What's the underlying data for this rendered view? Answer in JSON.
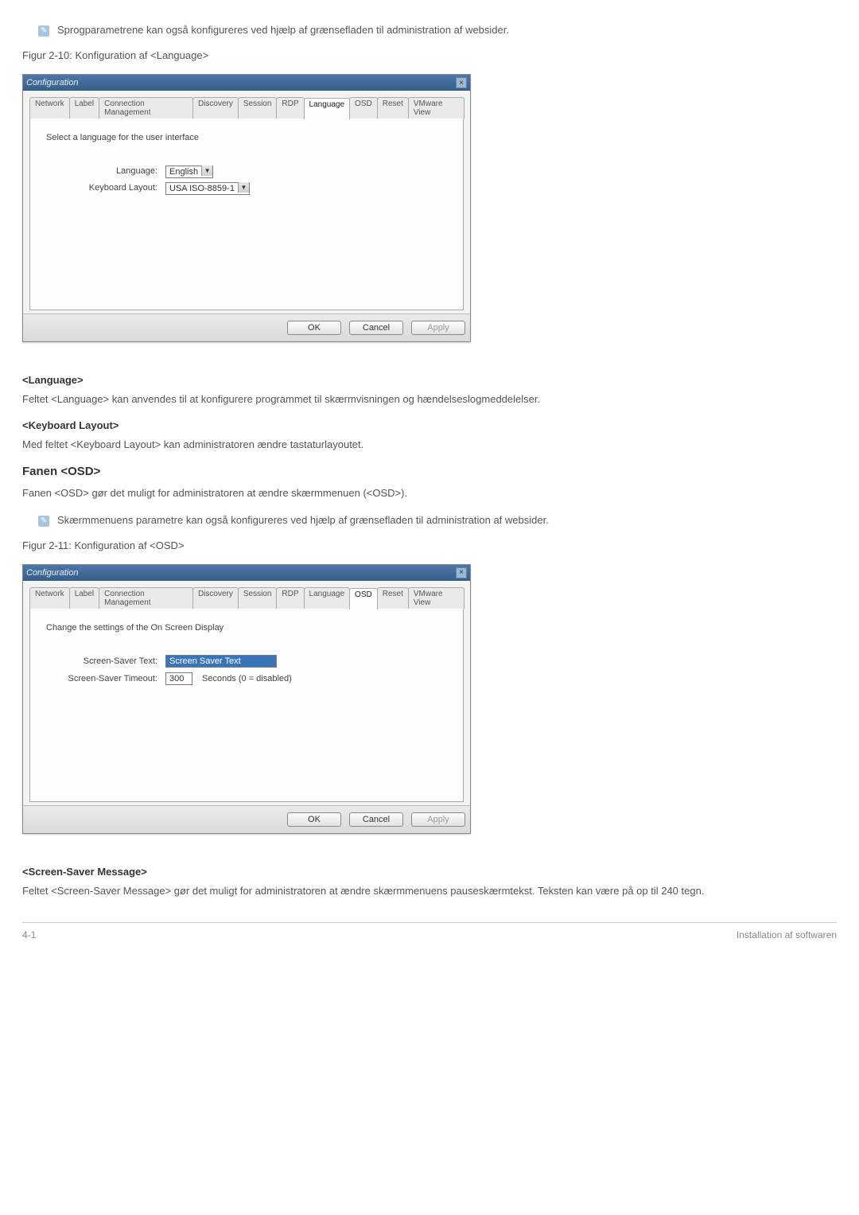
{
  "note1": "Sprogparametrene kan også konfigureres ved hjælp af grænsefladen til administration af websider.",
  "caption1": "Figur 2-10: Konfiguration af <Language>",
  "window1": {
    "title": "Configuration",
    "tabs": [
      "Network",
      "Label",
      "Connection Management",
      "Discovery",
      "Session",
      "RDP",
      "Language",
      "OSD",
      "Reset",
      "VMware View"
    ],
    "active_tab": "Language",
    "panel_caption": "Select a language for the user interface",
    "row1_label": "Language:",
    "row1_value": "English",
    "row2_label": "Keyboard Layout:",
    "row2_value": "USA ISO-8859-1",
    "ok": "OK",
    "cancel": "Cancel",
    "apply": "Apply"
  },
  "sec_lang_head": "<Language>",
  "sec_lang_p": "Feltet <Language> kan anvendes til at konfigurere programmet til skærmvisningen og hændelseslogmeddelelser.",
  "sec_kb_head": "<Keyboard Layout>",
  "sec_kb_p": "Med feltet <Keyboard Layout> kan administratoren ændre tastaturlayoutet.",
  "sec_osd_head": "Fanen <OSD>",
  "sec_osd_p": "Fanen <OSD> gør det muligt for administratoren at ændre skærmmenuen (<OSD>).",
  "note2": "Skærmmenuens parametre kan også konfigureres ved hjælp af grænsefladen til administration af websider.",
  "caption2": "Figur 2-11: Konfiguration af <OSD>",
  "window2": {
    "title": "Configuration",
    "tabs": [
      "Network",
      "Label",
      "Connection Management",
      "Discovery",
      "Session",
      "RDP",
      "Language",
      "OSD",
      "Reset",
      "VMware View"
    ],
    "active_tab": "OSD",
    "panel_caption": "Change the settings of the On Screen Display",
    "row1_label": "Screen-Saver Text:",
    "row1_value": "Screen Saver Text",
    "row2_label": "Screen-Saver Timeout:",
    "row2_value": "300",
    "row2_suffix": "Seconds (0 = disabled)",
    "ok": "OK",
    "cancel": "Cancel",
    "apply": "Apply"
  },
  "sec_ssm_head": "<Screen-Saver Message>",
  "sec_ssm_p": "Feltet <Screen-Saver Message> gør det muligt for administratoren at ændre skærmmenuens pauseskærmtekst. Teksten kan være på op til 240 tegn.",
  "footer_left": "4-1",
  "footer_right": "Installation af softwaren"
}
